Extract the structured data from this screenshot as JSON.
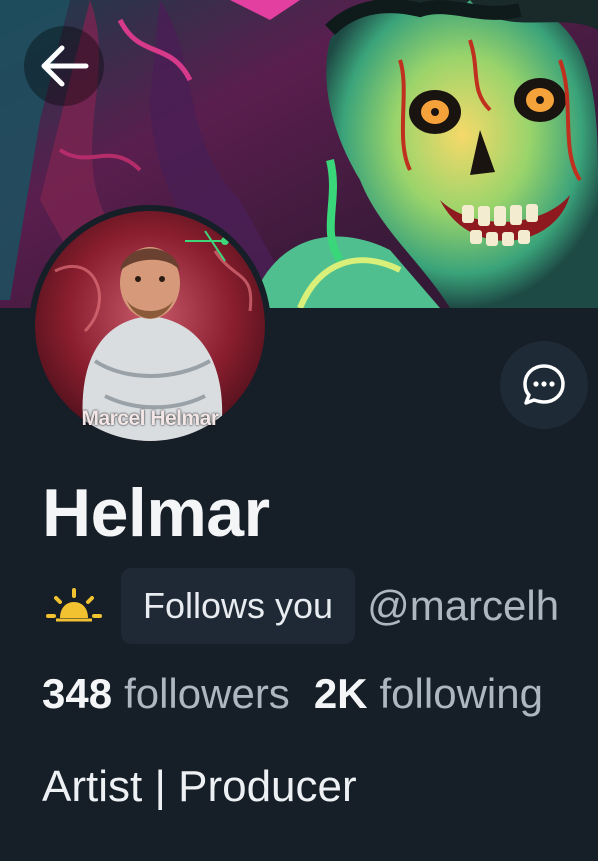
{
  "header": {
    "back_icon": "arrow-left-icon",
    "banner_icon": "zombie-artwork-banner"
  },
  "profile": {
    "avatar_text": "Marcel Helmar",
    "message_icon": "chat-bubble-icon",
    "name": "Helmar",
    "status_icon": "sun-horizon-icon",
    "follows_you": "Follows you",
    "handle": "@marcelh",
    "followers_count": "348",
    "followers_label": "followers",
    "following_count": "2K",
    "following_label": "following",
    "bio": "Artist | Producer"
  },
  "colors": {
    "background": "#161e27",
    "badge_bg": "#1e2935",
    "muted_text": "#aeb7c1",
    "accent_yellow": "#f2c230"
  }
}
